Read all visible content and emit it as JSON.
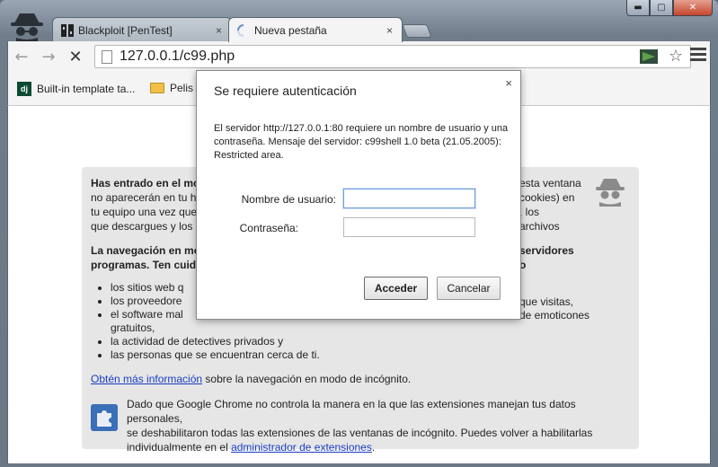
{
  "window": {
    "controls": {
      "minimize": "▬",
      "maximize": "▢",
      "close": "✕"
    }
  },
  "tabs": [
    {
      "label": "Blackploit [PenTest]",
      "icon": "blackploit-icon",
      "close": "×"
    },
    {
      "label": "Nueva pestaña",
      "icon": "loading-spinner-icon",
      "close": "×"
    }
  ],
  "toolbar": {
    "back": "←",
    "forward": "→",
    "stop": "✕",
    "url": "127.0.0.1/c99.php",
    "star": "☆"
  },
  "bookmarks": [
    {
      "label": "Built-in template ta...",
      "icon": "dj-icon",
      "icon_text": "dj"
    },
    {
      "label": "Pelis",
      "icon": "folder-icon"
    }
  ],
  "incognito": {
    "p1_bold": "Has entrado en el mo",
    "p1_lines": [
      "no aparecerán en tu hi",
      "tu equipo una vez que",
      "que descargues y los m"
    ],
    "p1_right": [
      "esta ventana",
      "cookies) en",
      ", los archivos"
    ],
    "p2_lines": [
      "La navegación en mod",
      "programas. Ten cuida"
    ],
    "p2_right": [
      "servidores o"
    ],
    "items": [
      {
        "left": "los sitios web q",
        "right": ""
      },
      {
        "left": "los proveedore",
        "right": "que visitas,"
      },
      {
        "left": "el software mal",
        "right": "de emoticones"
      },
      {
        "left": "gratuitos,",
        "right": ""
      },
      {
        "left": "la actividad de detectives privados y",
        "right": ""
      },
      {
        "left": "las personas que se encuentran cerca de ti.",
        "right": ""
      }
    ],
    "learn_link": "Obtén más información",
    "learn_rest": " sobre la navegación en modo de incógnito.",
    "ext_line1": "Dado que Google Chrome no controla la manera en la que las extensiones manejan tus datos personales,",
    "ext_line2": "se deshabilitaron todas las extensiones de las ventanas de incógnito. Puedes volver a habilitarlas",
    "ext_line3_prefix": "individualmente en el ",
    "ext_link": "administrador de extensiones",
    "ext_line3_suffix": "."
  },
  "dialog": {
    "title": "Se requiere autenticación",
    "close": "×",
    "message": "El servidor http://127.0.0.1:80 requiere un nombre de usuario y una contraseña. Mensaje del servidor: c99shell 1.0 beta (21.05.2005): Restricted area.",
    "user_label": "Nombre de usuario:",
    "user_value": "",
    "pass_label": "Contraseña:",
    "pass_value": "",
    "ok_label": "Acceder",
    "cancel_label": "Cancelar"
  }
}
